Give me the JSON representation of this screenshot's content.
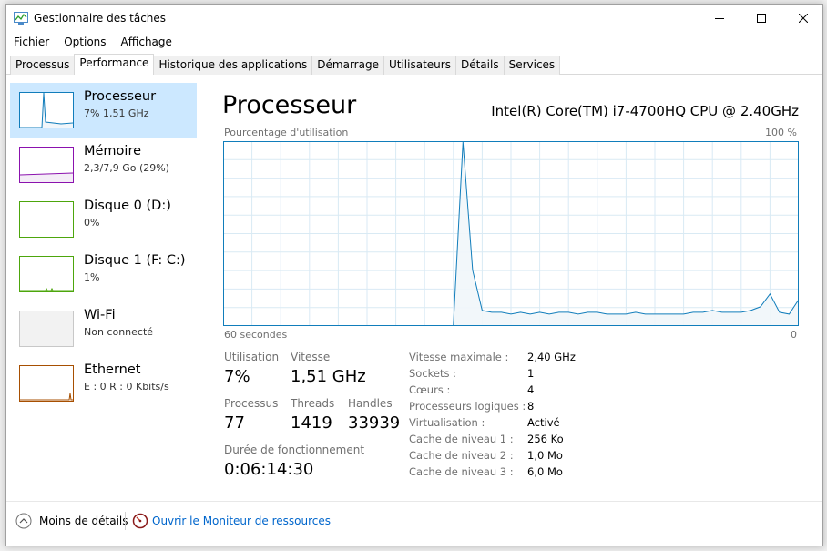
{
  "window": {
    "title": "Gestionnaire des tâches"
  },
  "menu": [
    "Fichier",
    "Options",
    "Affichage"
  ],
  "tabs": [
    "Processus",
    "Performance",
    "Historique des applications",
    "Démarrage",
    "Utilisateurs",
    "Détails",
    "Services"
  ],
  "sidebar": {
    "items": [
      {
        "name": "Processeur",
        "sub": "7% 1,51 GHz",
        "color": "#117dbb"
      },
      {
        "name": "Mémoire",
        "sub": "2,3/7,9 Go (29%)",
        "color": "#8b12ae"
      },
      {
        "name": "Disque 0 (D:)",
        "sub": "0%",
        "color": "#4da60c"
      },
      {
        "name": "Disque 1 (F: C:)",
        "sub": "1%",
        "color": "#4da60c"
      },
      {
        "name": "Wi-Fi",
        "sub": "Non connecté",
        "color": "#c0c0c0"
      },
      {
        "name": "Ethernet",
        "sub": "E : 0 R : 0 Kbits/s",
        "color": "#a74f01"
      }
    ]
  },
  "main": {
    "title": "Processeur",
    "cpu_name": "Intel(R) Core(TM) i7-4700HQ CPU @ 2.40GHz",
    "graph": {
      "top_left_label": "Pourcentage d'utilisation",
      "top_right_label": "100 %",
      "bottom_left_label": "60 secondes",
      "bottom_right_label": "0"
    }
  },
  "chart_data": {
    "type": "area",
    "title": "",
    "xlabel": "60 secondes",
    "ylabel": "Pourcentage d'utilisation",
    "xlim": [
      60,
      0
    ],
    "ylim": [
      0,
      100
    ],
    "x": [
      60,
      59,
      58,
      57,
      56,
      55,
      54,
      53,
      52,
      51,
      50,
      49,
      48,
      47,
      46,
      45,
      44,
      43,
      42,
      41,
      40,
      39,
      38,
      37,
      36,
      35,
      34,
      33,
      32,
      31,
      30,
      29,
      28,
      27,
      26,
      25,
      24,
      23,
      22,
      21,
      20,
      19,
      18,
      17,
      16,
      15,
      14,
      13,
      12,
      11,
      10,
      9,
      8,
      7,
      6,
      5,
      4,
      3,
      2,
      1,
      0
    ],
    "values": [
      0,
      0,
      0,
      0,
      0,
      0,
      0,
      0,
      0,
      0,
      0,
      0,
      0,
      0,
      0,
      0,
      0,
      0,
      0,
      0,
      0,
      0,
      0,
      0,
      0,
      100,
      30,
      8,
      7,
      7,
      6,
      7,
      6,
      7,
      6,
      7,
      7,
      6,
      7,
      7,
      6,
      6,
      6,
      7,
      6,
      6,
      6,
      6,
      6,
      7,
      7,
      8,
      7,
      7,
      7,
      8,
      10,
      17,
      7,
      6,
      14
    ]
  },
  "stats": {
    "utilisation_label": "Utilisation",
    "utilisation_value": "7%",
    "vitesse_label": "Vitesse",
    "vitesse_value": "1,51 GHz",
    "processus_label": "Processus",
    "processus_value": "77",
    "threads_label": "Threads",
    "threads_value": "1419",
    "handles_label": "Handles",
    "handles_value": "33939",
    "uptime_label": "Durée de fonctionnement",
    "uptime_value": "0:06:14:30"
  },
  "specs": [
    {
      "label": "Vitesse maximale :",
      "value": "2,40 GHz"
    },
    {
      "label": "Sockets :",
      "value": "1"
    },
    {
      "label": "Cœurs :",
      "value": "4"
    },
    {
      "label": "Processeurs logiques :",
      "value": "8"
    },
    {
      "label": "Virtualisation :",
      "value": "Activé"
    },
    {
      "label": "Cache de niveau 1 :",
      "value": "256 Ko"
    },
    {
      "label": "Cache de niveau 2 :",
      "value": "1,0 Mo"
    },
    {
      "label": "Cache de niveau 3 :",
      "value": "6,0 Mo"
    }
  ],
  "footer": {
    "fewer_details": "Moins de détails",
    "resource_monitor": "Ouvrir le Moniteur de ressources"
  },
  "colors": {
    "cpu_line": "#117dbb",
    "cpu_fill": "#f1f6fa",
    "grid": "#d9eaf4",
    "link": "#0066cc",
    "selected": "#cce8ff"
  }
}
